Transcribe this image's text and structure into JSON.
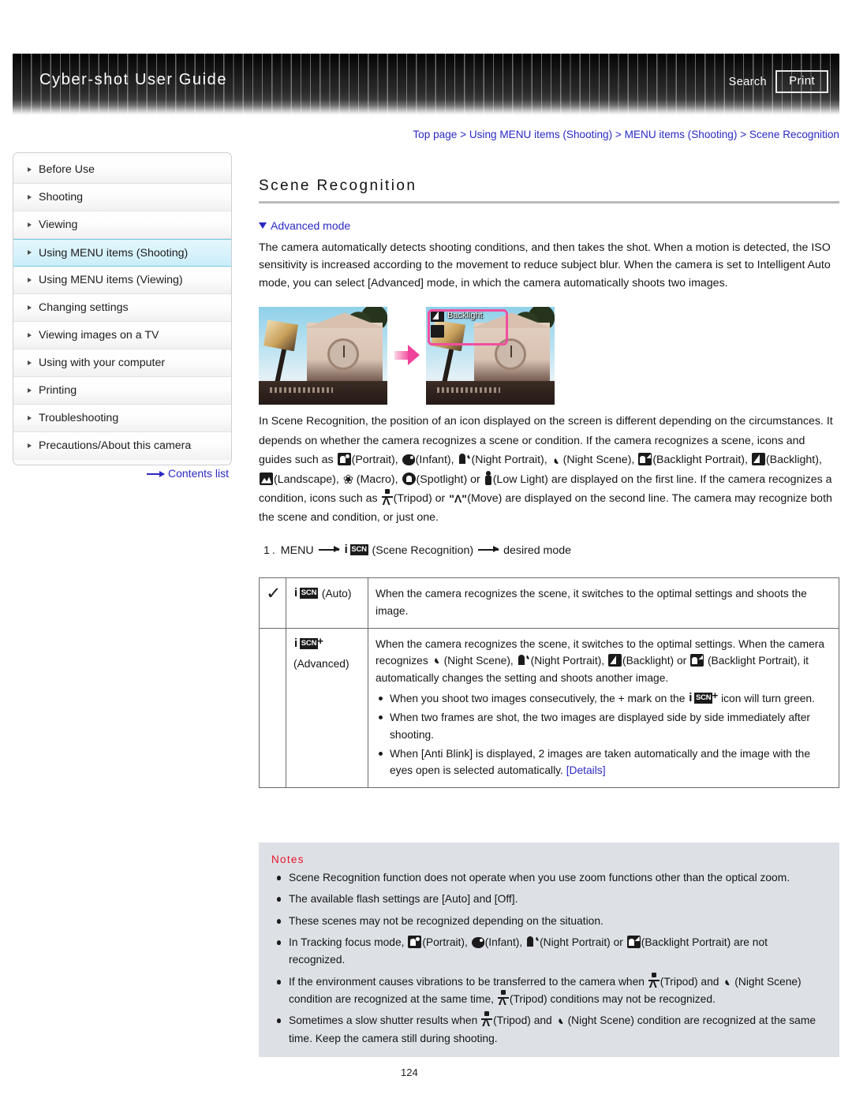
{
  "header": {
    "title": "Cyber-shot User Guide",
    "search_label": "Search",
    "print_label": "Print"
  },
  "breadcrumb": {
    "text": "Top page > Using MENU items (Shooting) > MENU items (Shooting) > Scene Recognition"
  },
  "sidebar": {
    "items": [
      {
        "label": "Before Use",
        "active": false
      },
      {
        "label": "Shooting",
        "active": false
      },
      {
        "label": "Viewing",
        "active": false
      },
      {
        "label": "Using MENU items (Shooting)",
        "active": true
      },
      {
        "label": "Using MENU items (Viewing)",
        "active": false
      },
      {
        "label": "Changing settings",
        "active": false
      },
      {
        "label": "Viewing images on a TV",
        "active": false
      },
      {
        "label": "Using with your computer",
        "active": false
      },
      {
        "label": "Printing",
        "active": false
      },
      {
        "label": "Troubleshooting",
        "active": false
      },
      {
        "label": "Precautions/About this camera",
        "active": false
      }
    ],
    "contents_link": "Contents list"
  },
  "main": {
    "title": "Scene Recognition",
    "advanced_mode_link": "Advanced mode",
    "intro_paragraph": "The camera automatically detects shooting conditions, and then takes the shot. When a motion is detected, the ISO sensitivity is increased according to the movement to reduce subject blur. When the camera is set to Intelligent Auto mode, you can select [Advanced] mode, in which the camera automatically shoots two images.",
    "illustration": {
      "osd_label": "Backlight"
    },
    "body_p1_a": "In Scene Recognition, the position of an icon displayed on the screen is different depending on the circumstances. It depends on whether the camera recognizes a scene or condition. If the camera recognizes a scene, icons and guides such as ",
    "labels": {
      "portrait": "(Portrait),",
      "infant": "(Infant),",
      "night_portrait": "(Night Portrait),",
      "night_scene_open": "(Night",
      "scene_word": "Scene),",
      "backlight_portrait": "(Backlight Portrait),",
      "backlight": "(Backlight),",
      "landscape": "(Landscape),",
      "macro": "(Macro),",
      "spotlight": "(Spotlight) or",
      "low_light_open": "(Low",
      "light_word": "Light) are displayed on the first line. If the camera recognizes a condition, icons such as",
      "tripod_or": "(Tripod) or",
      "move_tail": "(Move) are displayed on the second line. The camera may recognize both the scene and condition, or just one."
    },
    "step": {
      "number": "1.",
      "menu": "MENU",
      "scene_recognition": "(Scene Recognition)",
      "desired_mode": "desired mode"
    },
    "table": {
      "rows": [
        {
          "checked": true,
          "mode": "(Auto)",
          "description": "When the camera recognizes the scene, it switches to the optimal settings and shoots the image.",
          "bullets": []
        },
        {
          "checked": false,
          "mode": "(Advanced)",
          "desc_a": "When the camera recognizes the scene, it switches to the optimal settings. When the camera recognizes ",
          "desc_night_scene": "(Night Scene),",
          "desc_night_portrait": "(Night Portrait),",
          "desc_backlight": "(Backlight) or",
          "desc_tail": "(Backlight Portrait), it automatically changes the setting and shoots another image.",
          "bullets": [
            {
              "a": "When you shoot two images consecutively, the + mark on the",
              "b": "icon will turn green."
            },
            {
              "a": "When two frames are shot, the two images are displayed side by side immediately after shooting.",
              "b": ""
            },
            {
              "a": "When [Anti Blink] is displayed, 2 images are taken automatically and the image with the eyes open is selected automatically.",
              "b": "",
              "link": "[Details]"
            }
          ]
        }
      ]
    }
  },
  "notes": {
    "title": "Notes",
    "items": [
      {
        "text": "Scene Recognition function does not operate when you use zoom functions other than the optical zoom."
      },
      {
        "text": "The available flash settings are [Auto] and [Off]."
      },
      {
        "text": "These scenes may not be recognized depending on the situation."
      },
      {
        "prefix": "In Tracking focus mode,",
        "portrait": "(Portrait),",
        "infant": "(Infant),",
        "night_portrait": "(Night Portrait) or",
        "backlight_portrait": "(Backlight Portrait) are not recognized."
      },
      {
        "prefix": "If the environment causes vibrations to be transferred to the camera when",
        "tripod": "(Tripod) and",
        "night_open": "(Night",
        "middle": "Scene) condition are recognized at the same time,",
        "tripod2": "(Tripod) conditions may not be recognized."
      },
      {
        "prefix": "Sometimes a slow shutter results when",
        "tripod": "(Tripod) and",
        "night_scene": "(Night Scene) condition are recognized at the same time. Keep the camera still during shooting."
      }
    ]
  },
  "page_number": "124",
  "colors": {
    "link": "#2b29c4",
    "notes_title": "#e8142a",
    "notes_bg": "#dde1e6",
    "active_nav": "#c9eefa",
    "osd_border": "#ef4fa0"
  }
}
